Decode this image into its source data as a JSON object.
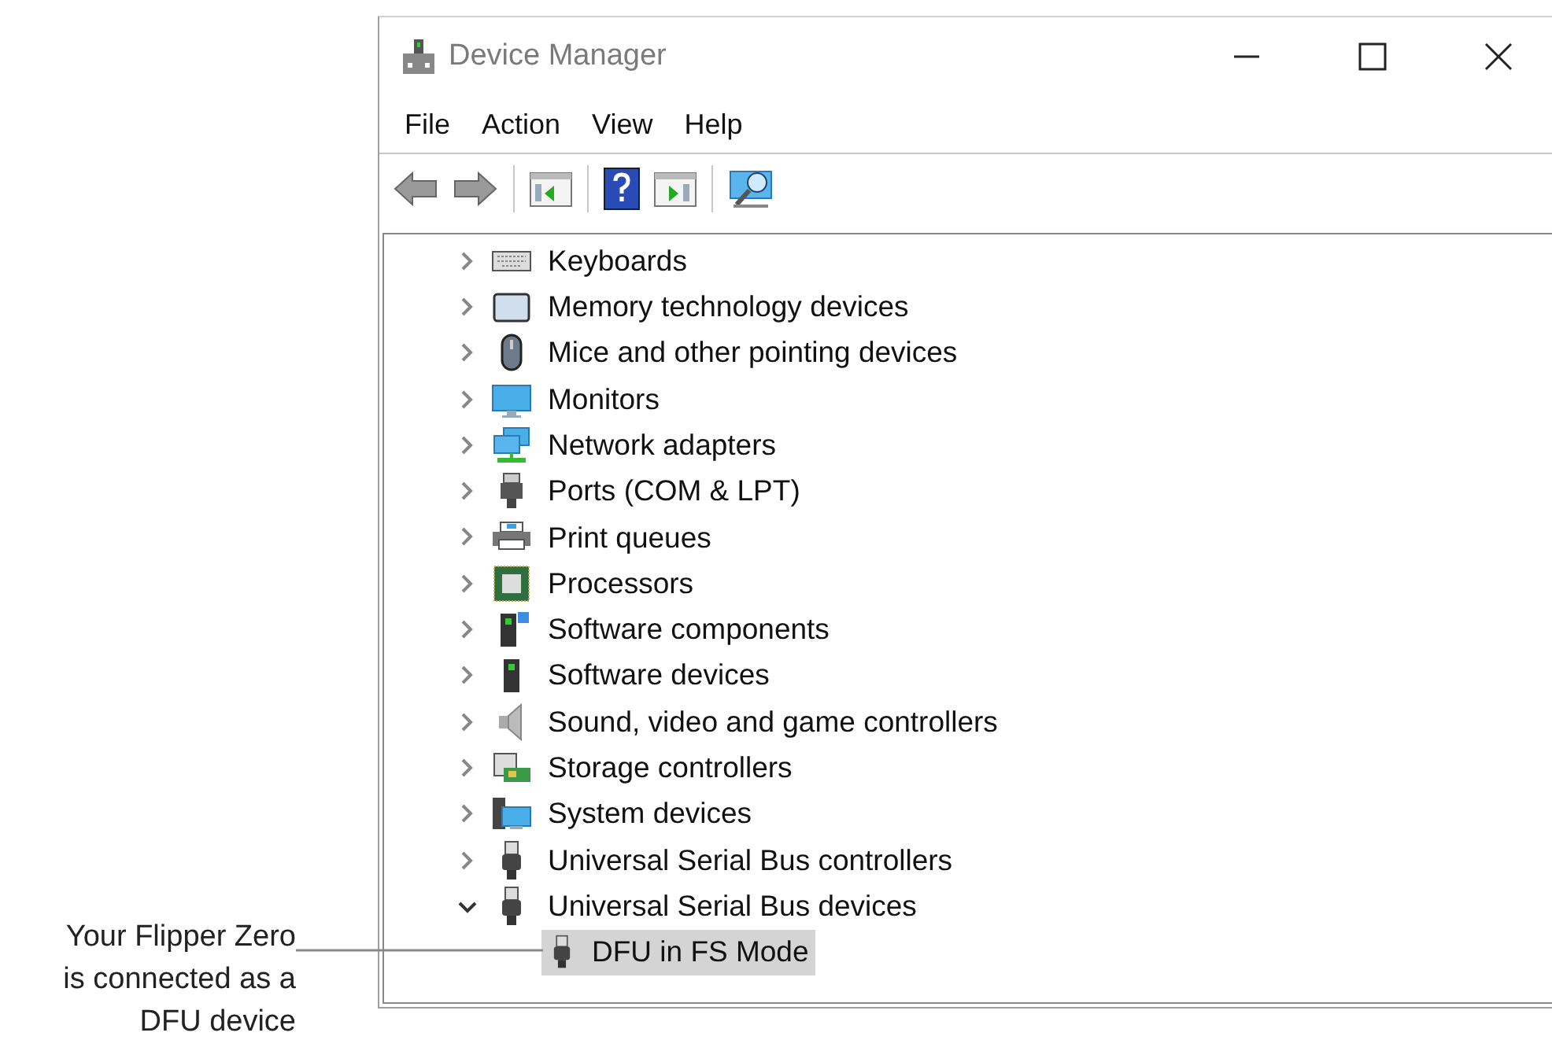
{
  "window": {
    "title": "Device Manager"
  },
  "menu": [
    "File",
    "Action",
    "View",
    "Help"
  ],
  "tree": [
    {
      "label": "Keyboards",
      "expanded": false,
      "selected": false
    },
    {
      "label": "Memory technology devices",
      "expanded": false,
      "selected": false
    },
    {
      "label": "Mice and other pointing devices",
      "expanded": false,
      "selected": false
    },
    {
      "label": "Monitors",
      "expanded": false,
      "selected": false
    },
    {
      "label": "Network adapters",
      "expanded": false,
      "selected": false
    },
    {
      "label": "Ports (COM & LPT)",
      "expanded": false,
      "selected": false
    },
    {
      "label": "Print queues",
      "expanded": false,
      "selected": false
    },
    {
      "label": "Processors",
      "expanded": false,
      "selected": false
    },
    {
      "label": "Software components",
      "expanded": false,
      "selected": false
    },
    {
      "label": "Software devices",
      "expanded": false,
      "selected": false
    },
    {
      "label": "Sound, video and game controllers",
      "expanded": false,
      "selected": false
    },
    {
      "label": "Storage controllers",
      "expanded": false,
      "selected": false
    },
    {
      "label": "System devices",
      "expanded": false,
      "selected": false
    },
    {
      "label": "Universal Serial Bus controllers",
      "expanded": false,
      "selected": false
    },
    {
      "label": "Universal Serial Bus devices",
      "expanded": true,
      "selected": false,
      "children": [
        {
          "label": "DFU in FS Mode",
          "selected": true
        }
      ]
    }
  ],
  "annotation": {
    "lines": [
      "Your Flipper Zero",
      "is connected as a",
      "DFU device"
    ]
  }
}
